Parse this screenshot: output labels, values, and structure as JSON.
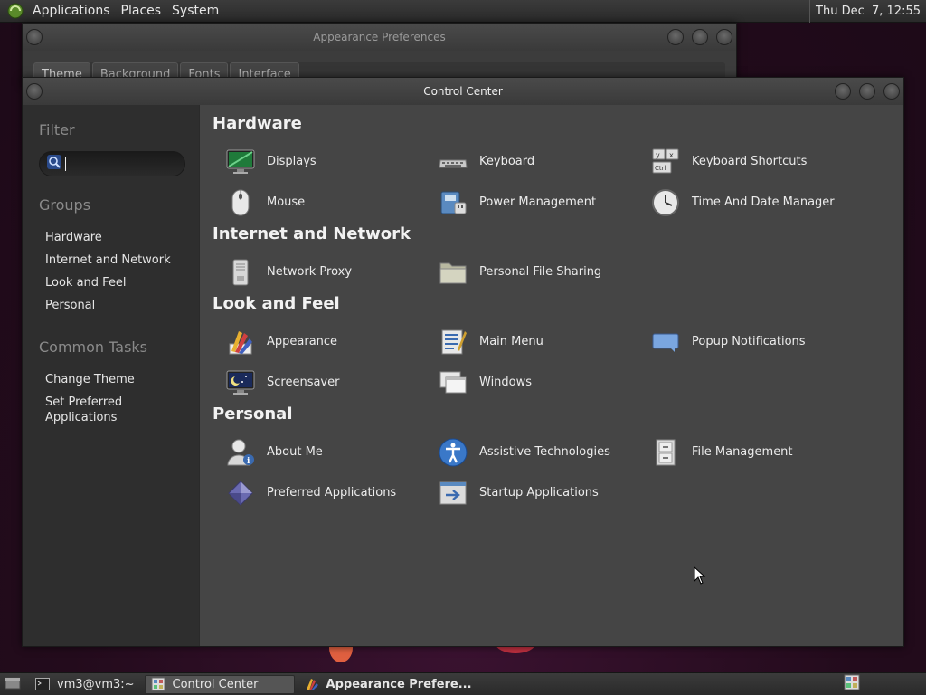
{
  "top_panel": {
    "menus": [
      "Applications",
      "Places",
      "System"
    ],
    "clock": "Thu Dec  7, 12:55"
  },
  "appearance_window": {
    "title": "Appearance Preferences",
    "tabs": [
      "Theme",
      "Background",
      "Fonts",
      "Interface"
    ]
  },
  "control_center": {
    "title": "Control Center",
    "sidebar": {
      "filter_heading": "Filter",
      "search_value": "",
      "groups_heading": "Groups",
      "groups": [
        "Hardware",
        "Internet and Network",
        "Look and Feel",
        "Personal"
      ],
      "tasks_heading": "Common Tasks",
      "tasks": [
        "Change Theme",
        "Set Preferred Applications"
      ]
    },
    "sections": [
      {
        "title": "Hardware",
        "items": [
          {
            "label": "Displays",
            "icon": "monitor-icon"
          },
          {
            "label": "Keyboard",
            "icon": "keyboard-icon"
          },
          {
            "label": "Keyboard Shortcuts",
            "icon": "keyboard-shortcuts-icon"
          },
          {
            "label": "Mouse",
            "icon": "mouse-icon"
          },
          {
            "label": "Power Management",
            "icon": "power-management-icon"
          },
          {
            "label": "Time And Date Manager",
            "icon": "clock-icon"
          }
        ]
      },
      {
        "title": "Internet and Network",
        "items": [
          {
            "label": "Network Proxy",
            "icon": "network-proxy-icon"
          },
          {
            "label": "Personal File Sharing",
            "icon": "folder-share-icon"
          }
        ]
      },
      {
        "title": "Look and Feel",
        "items": [
          {
            "label": "Appearance",
            "icon": "palette-icon"
          },
          {
            "label": "Main Menu",
            "icon": "main-menu-icon"
          },
          {
            "label": "Popup Notifications",
            "icon": "notification-icon"
          },
          {
            "label": "Screensaver",
            "icon": "screensaver-icon"
          },
          {
            "label": "Windows",
            "icon": "windows-icon"
          }
        ]
      },
      {
        "title": "Personal",
        "items": [
          {
            "label": "About Me",
            "icon": "user-info-icon"
          },
          {
            "label": "Assistive Technologies",
            "icon": "accessibility-icon"
          },
          {
            "label": "File Management",
            "icon": "file-cabinet-icon"
          },
          {
            "label": "Preferred Applications",
            "icon": "preferred-apps-icon"
          },
          {
            "label": "Startup Applications",
            "icon": "startup-apps-icon"
          }
        ]
      }
    ]
  },
  "bottom_panel": {
    "tasks": [
      "vm3@vm3:~",
      "Control Center",
      "Appearance Prefere..."
    ]
  }
}
